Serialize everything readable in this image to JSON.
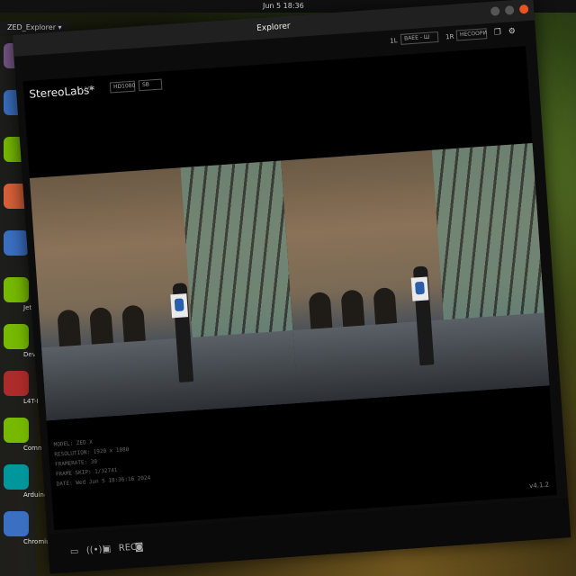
{
  "topbar": {
    "clock": "Jun 5 18:36",
    "system_icons": "⌂ ♪ ⏻"
  },
  "app_strip": {
    "label": "ZED_Explorer ▾"
  },
  "dock": {
    "items": [
      {
        "label": "",
        "color": "#7a5a8a"
      },
      {
        "label": "Th",
        "color": "#3a6fc1"
      },
      {
        "label": "Jetson",
        "color": "#76b900"
      },
      {
        "label": "",
        "color": "#d8603a"
      },
      {
        "label": "",
        "color": "#3a6fc1"
      },
      {
        "label": "Jetson S Foru",
        "color": "#76b900"
      },
      {
        "label": "Develo",
        "color": "#76b900"
      },
      {
        "label": "L4T-RE",
        "color": "#ad2b2b"
      },
      {
        "label": "Communi gu",
        "color": "#76b900"
      },
      {
        "label": "Arduino ID",
        "color": "#00979c"
      },
      {
        "label": "Chromium We",
        "color": "#3a6fc1"
      }
    ]
  },
  "window": {
    "title": "Explorer",
    "toolbar": {
      "label_1": "1L",
      "select_1": "ВАЕЕ - Ш",
      "label_2": "1R",
      "select_2": "НЕСООРИ",
      "icons": [
        "copy-icon",
        "gear-icon"
      ]
    },
    "header": {
      "brand": "StereoLabs*",
      "live": "LIVE",
      "resolution_select": "HD1080",
      "view_select": "SB"
    },
    "info": {
      "lines": [
        "MODEL: ZED X",
        "RESOLUTION: 1920 x 1080",
        "FRAMERATE: 30",
        "FRAME SKIP: 1/32741",
        "DATE: Wed Jun 5 18:36:16 2024"
      ]
    },
    "version": "v4.1.2",
    "bottom_icons": [
      "folder-icon",
      "broadcast-icon",
      "record-icon",
      "rec-label",
      "camera-icon"
    ],
    "bottom_icon_glyphs": [
      "▭",
      "((•))",
      "▣",
      "REC",
      "◙"
    ]
  }
}
